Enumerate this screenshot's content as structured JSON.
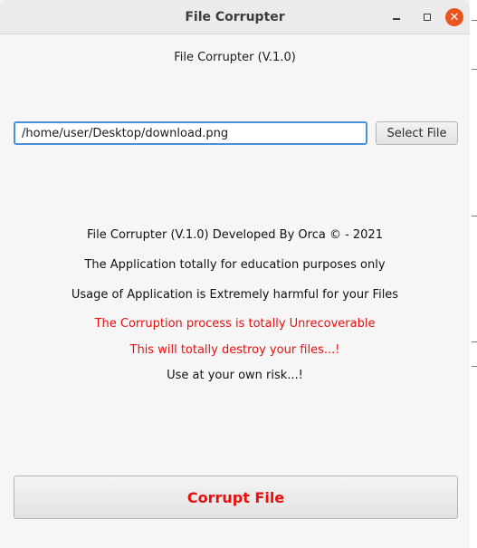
{
  "window": {
    "title": "File Corrupter",
    "controls": {
      "minimize_icon": "minimize-icon",
      "maximize_icon": "maximize-icon",
      "close_icon": "close-icon",
      "close_symbol": "✕"
    },
    "close_color": "#e95420"
  },
  "header": {
    "title": "File Corrupter (V.1.0)"
  },
  "file": {
    "path_value": "/home/user/Desktop/download.png",
    "select_label": "Select File"
  },
  "info": {
    "lines": [
      "File Corrupter (V.1.0) Developed By Orca  © - 2021",
      "The Application totally for education purposes only",
      "Usage of Application is Extremely harmful for your Files"
    ],
    "warnings": [
      "The Corruption process is totally Unrecoverable",
      "This will totally destroy your files...!"
    ],
    "risk": "Use at your own risk...!"
  },
  "action": {
    "corrupt_label": "Corrupt File"
  },
  "colors": {
    "warning": "#e81010",
    "focus_border": "#4a90d9"
  }
}
